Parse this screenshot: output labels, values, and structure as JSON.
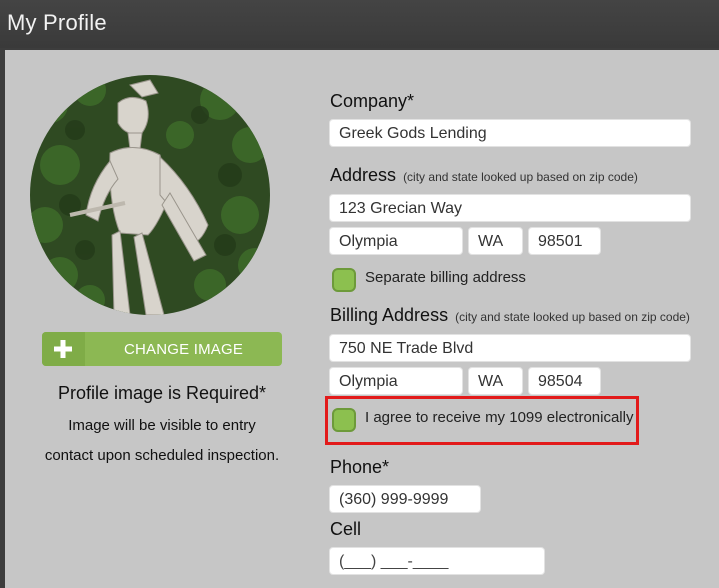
{
  "header": {
    "title": "My Profile"
  },
  "profile_image": {
    "button_label": "CHANGE IMAGE",
    "required_title": "Profile image is Required*",
    "description_line1": "Image will be visible to entry",
    "description_line2": "contact upon scheduled inspection."
  },
  "company": {
    "label": "Company*",
    "value": "Greek Gods Lending"
  },
  "address": {
    "label": "Address",
    "hint": "(city and state looked up based on zip code)",
    "street": "123 Grecian Way",
    "city": "Olympia",
    "state": "WA",
    "zip": "98501"
  },
  "separate_billing": {
    "label": "Separate billing address",
    "checked": true
  },
  "billing_address": {
    "label": "Billing Address",
    "hint": "(city and state looked up based on zip code)",
    "street": "750 NE Trade Blvd",
    "city": "Olympia",
    "state": "WA",
    "zip": "98504"
  },
  "consent_1099": {
    "label": "I agree to receive my 1099 electronically",
    "checked": true
  },
  "phone": {
    "label": "Phone*",
    "value": "(360) 999-9999"
  },
  "cell": {
    "label": "Cell",
    "placeholder": "(___) ___-____"
  },
  "colors": {
    "accent_green": "#8cb853",
    "highlight_red": "#e21a1a",
    "topbar": "#3d3d3d",
    "panel": "#c6c6c6"
  },
  "icons": {
    "change_image": "plus-icon",
    "checkbox": "checkbox-checked-icon"
  }
}
